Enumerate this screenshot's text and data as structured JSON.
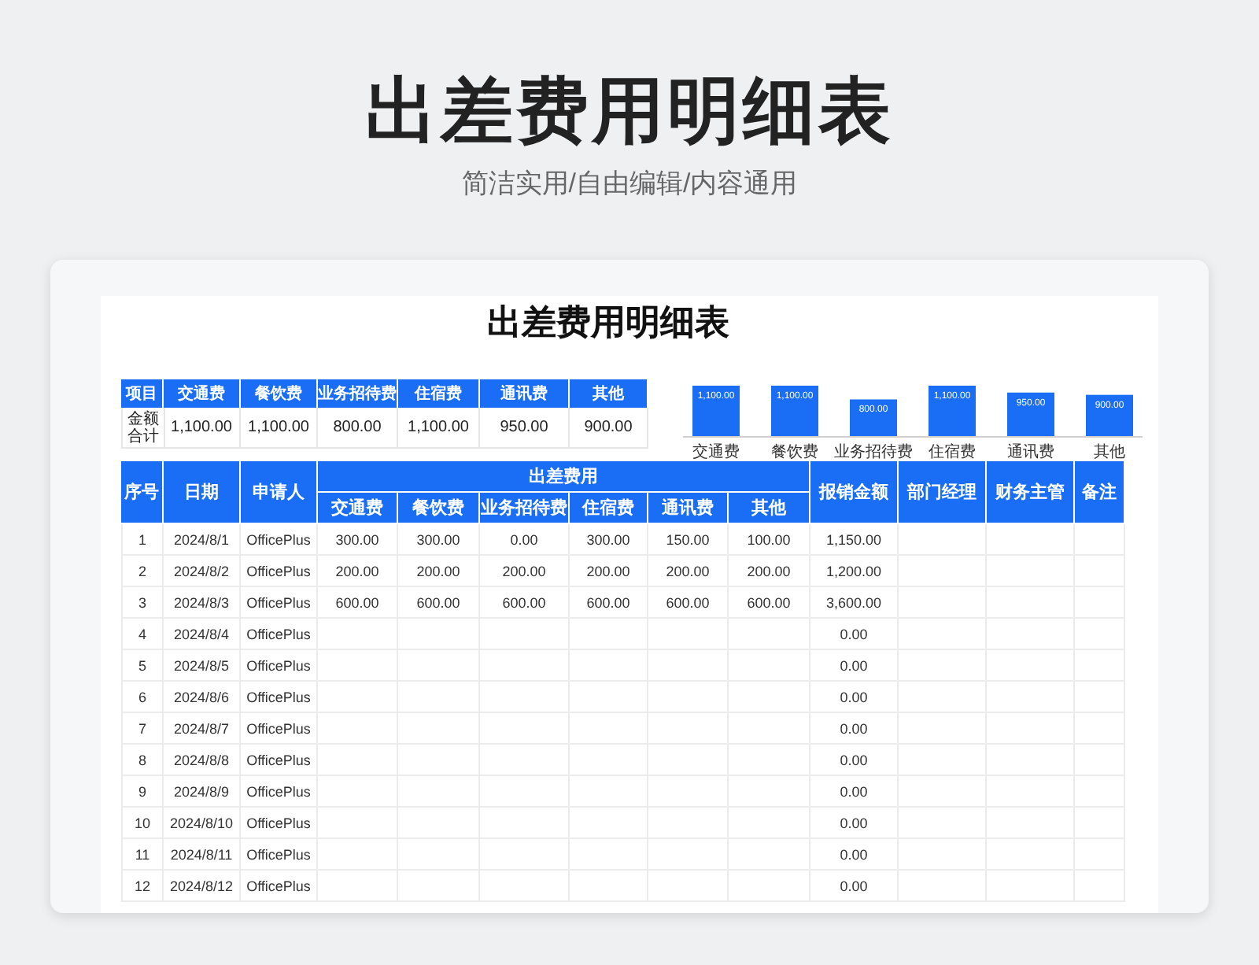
{
  "title": "出差费用明细表",
  "subtitle": "简洁实用/自由编辑/内容通用",
  "sheet": {
    "title": "出差费用明细表",
    "summary": {
      "columns": [
        "项目",
        "交通费",
        "餐饮费",
        "业务招待费",
        "住宿费",
        "通讯费",
        "其他"
      ],
      "row_label": "金额合计",
      "values": [
        "1,100.00",
        "1,100.00",
        "800.00",
        "1,100.00",
        "950.00",
        "900.00"
      ]
    },
    "chart": {
      "chart_data": {
        "type": "bar",
        "categories": [
          "交通费",
          "餐饮费",
          "业务招待费",
          "住宿费",
          "通讯费",
          "其他"
        ],
        "values": [
          1100,
          1100,
          800,
          1100,
          950,
          900
        ],
        "value_labels": [
          "1,100.00",
          "1,100.00",
          "800.00",
          "1,100.00",
          "950.00",
          "900.00"
        ]
      }
    },
    "table": {
      "columns_before": [
        "序号",
        "日期",
        "申请人"
      ],
      "group": {
        "label": "出差费用",
        "columns": [
          "交通费",
          "餐饮费",
          "业务招待费",
          "住宿费",
          "通讯费",
          "其他"
        ]
      },
      "columns_after": [
        "报销金额",
        "部门经理",
        "财务主管",
        "备注"
      ],
      "rows": [
        {
          "no": "1",
          "date": "2024/8/1",
          "applicant": "OfficePlus",
          "expenses": [
            "300.00",
            "300.00",
            "0.00",
            "300.00",
            "150.00",
            "100.00"
          ],
          "total": "1,150.00"
        },
        {
          "no": "2",
          "date": "2024/8/2",
          "applicant": "OfficePlus",
          "expenses": [
            "200.00",
            "200.00",
            "200.00",
            "200.00",
            "200.00",
            "200.00"
          ],
          "total": "1,200.00"
        },
        {
          "no": "3",
          "date": "2024/8/3",
          "applicant": "OfficePlus",
          "expenses": [
            "600.00",
            "600.00",
            "600.00",
            "600.00",
            "600.00",
            "600.00"
          ],
          "total": "3,600.00"
        },
        {
          "no": "4",
          "date": "2024/8/4",
          "applicant": "OfficePlus",
          "total": "0.00"
        },
        {
          "no": "5",
          "date": "2024/8/5",
          "applicant": "OfficePlus",
          "total": "0.00"
        },
        {
          "no": "6",
          "date": "2024/8/6",
          "applicant": "OfficePlus",
          "total": "0.00"
        },
        {
          "no": "7",
          "date": "2024/8/7",
          "applicant": "OfficePlus",
          "total": "0.00"
        },
        {
          "no": "8",
          "date": "2024/8/8",
          "applicant": "OfficePlus",
          "total": "0.00"
        },
        {
          "no": "9",
          "date": "2024/8/9",
          "applicant": "OfficePlus",
          "total": "0.00"
        },
        {
          "no": "10",
          "date": "2024/8/10",
          "applicant": "OfficePlus",
          "total": "0.00"
        },
        {
          "no": "11",
          "date": "2024/8/11",
          "applicant": "OfficePlus",
          "total": "0.00"
        },
        {
          "no": "12",
          "date": "2024/8/12",
          "applicant": "OfficePlus",
          "total": "0.00"
        }
      ]
    }
  }
}
